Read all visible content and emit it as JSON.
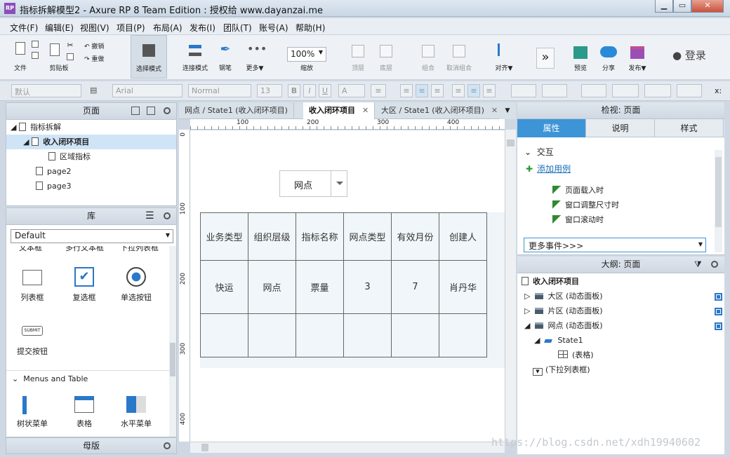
{
  "window": {
    "title": "指标拆解模型2 - Axure RP 8 Team Edition : 授权给 www.dayanzai.me",
    "app_icon_text": "RP",
    "min": "▁",
    "restore": "▭",
    "close": "✕"
  },
  "menu": [
    "文件(F)",
    "编辑(E)",
    "视图(V)",
    "项目(P)",
    "布局(A)",
    "发布(I)",
    "团队(T)",
    "账号(A)",
    "帮助(H)"
  ],
  "toolbar": {
    "file": "文件",
    "clipboard": "剪贴板",
    "undo": "撤销",
    "redo": "重做",
    "select_mode": "选择模式",
    "connect_mode": "连接模式",
    "pen": "钢笔",
    "more": "更多▼",
    "zoom_value": "100%",
    "zoom": "缩放",
    "top": "顶层",
    "bottom": "底层",
    "group": "组合",
    "ungroup": "取消组合",
    "align": "对齐▼",
    "preview": "预览",
    "share": "分享",
    "publish": "发布▼",
    "login": "登录"
  },
  "format": {
    "style": "默认",
    "font": "Arial",
    "weight": "Normal",
    "size": "13",
    "bold": "B",
    "italic": "I",
    "underline": "U",
    "font_color": "A",
    "x_label": "x:"
  },
  "pages_panel": {
    "title": "页面",
    "items": [
      {
        "label": "指标拆解",
        "selected": false
      },
      {
        "label": "收入闭环项目",
        "selected": true
      },
      {
        "label": "区域指标",
        "selected": false
      },
      {
        "label": "page2",
        "selected": false
      },
      {
        "label": "page3",
        "selected": false
      }
    ]
  },
  "library_panel": {
    "title": "库",
    "selected_library": "Default",
    "cut_labels": [
      "文本框",
      "多行文本框",
      "下拉列表框"
    ],
    "widgets": [
      "列表框",
      "复选框",
      "单选按钮",
      "提交按钮"
    ],
    "submit_text": "SUBMIT",
    "section": "Menus and Table",
    "menu_widgets": [
      "树状菜单",
      "表格",
      "水平菜单"
    ]
  },
  "master_panel": {
    "title": "母版"
  },
  "tabs": [
    {
      "label": "网点 / State1 (收入闭环项目)",
      "active": false
    },
    {
      "label": "收入闭环项目",
      "active": true
    },
    {
      "label": "大区 / State1 (收入闭环项目)",
      "active": false
    }
  ],
  "ruler": {
    "h": [
      "100",
      "200",
      "300",
      "400"
    ],
    "v": [
      "0",
      "100",
      "200",
      "300",
      "400"
    ]
  },
  "canvas": {
    "dropdown_value": "网点",
    "table": {
      "headers": [
        "业务类型",
        "组织层级",
        "指标名称",
        "网点类型",
        "有效月份",
        "创建人"
      ],
      "row1": [
        "快运",
        "网点",
        "票量",
        "3",
        "7",
        "肖丹华"
      ],
      "row2": [
        "",
        "",
        "",
        "",
        "",
        ""
      ]
    }
  },
  "inspector": {
    "title": "检视: 页面",
    "tabs": [
      "属性",
      "说明",
      "样式"
    ],
    "section": "交互",
    "add_case": "添加用例",
    "events": [
      "页面载入时",
      "窗口调整尺寸时",
      "窗口滚动时"
    ],
    "more_events": "更多事件>>>"
  },
  "outline": {
    "title": "大纲: 页面",
    "root": "收入闭环项目",
    "items": [
      {
        "label": "大区 (动态面板)"
      },
      {
        "label": "片区 (动态面板)"
      },
      {
        "label": "网点 (动态面板)"
      },
      {
        "label": "State1"
      },
      {
        "label": "(表格)"
      },
      {
        "label": "(下拉列表框)"
      }
    ]
  },
  "watermark": "https://blog.csdn.net/xdh19940602"
}
